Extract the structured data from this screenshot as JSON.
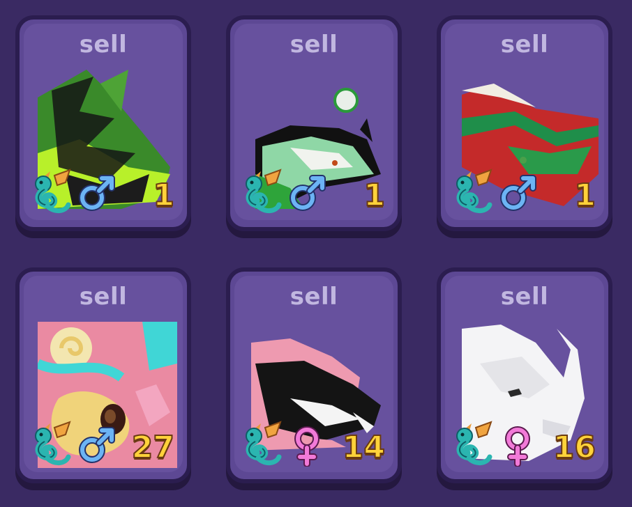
{
  "sell_label": "sell",
  "colors": {
    "background": "#3a2a63",
    "card": "#67519e",
    "card_border": "#2b1d4f",
    "sell_text": "#c1b7e0",
    "count_text": "#ffd23a",
    "male": "#5aa8f0",
    "female": "#f07ad8"
  },
  "pets": [
    {
      "name": "green-black-dragon",
      "gender": "male",
      "count": "1",
      "gender_icon": "male-icon",
      "type_icon": "dragon-icon"
    },
    {
      "name": "mint-black-dragon",
      "gender": "male",
      "count": "1",
      "gender_icon": "male-icon",
      "type_icon": "dragon-icon"
    },
    {
      "name": "red-green-dragon",
      "gender": "male",
      "count": "1",
      "gender_icon": "male-icon",
      "type_icon": "dragon-icon"
    },
    {
      "name": "pink-cyan-swirl-dragon",
      "gender": "male",
      "count": "27",
      "gender_icon": "male-icon",
      "type_icon": "dragon-icon"
    },
    {
      "name": "pink-black-dragon",
      "gender": "female",
      "count": "14",
      "gender_icon": "female-icon",
      "type_icon": "dragon-icon"
    },
    {
      "name": "white-dragon",
      "gender": "female",
      "count": "16",
      "gender_icon": "female-icon",
      "type_icon": "dragon-icon"
    }
  ]
}
